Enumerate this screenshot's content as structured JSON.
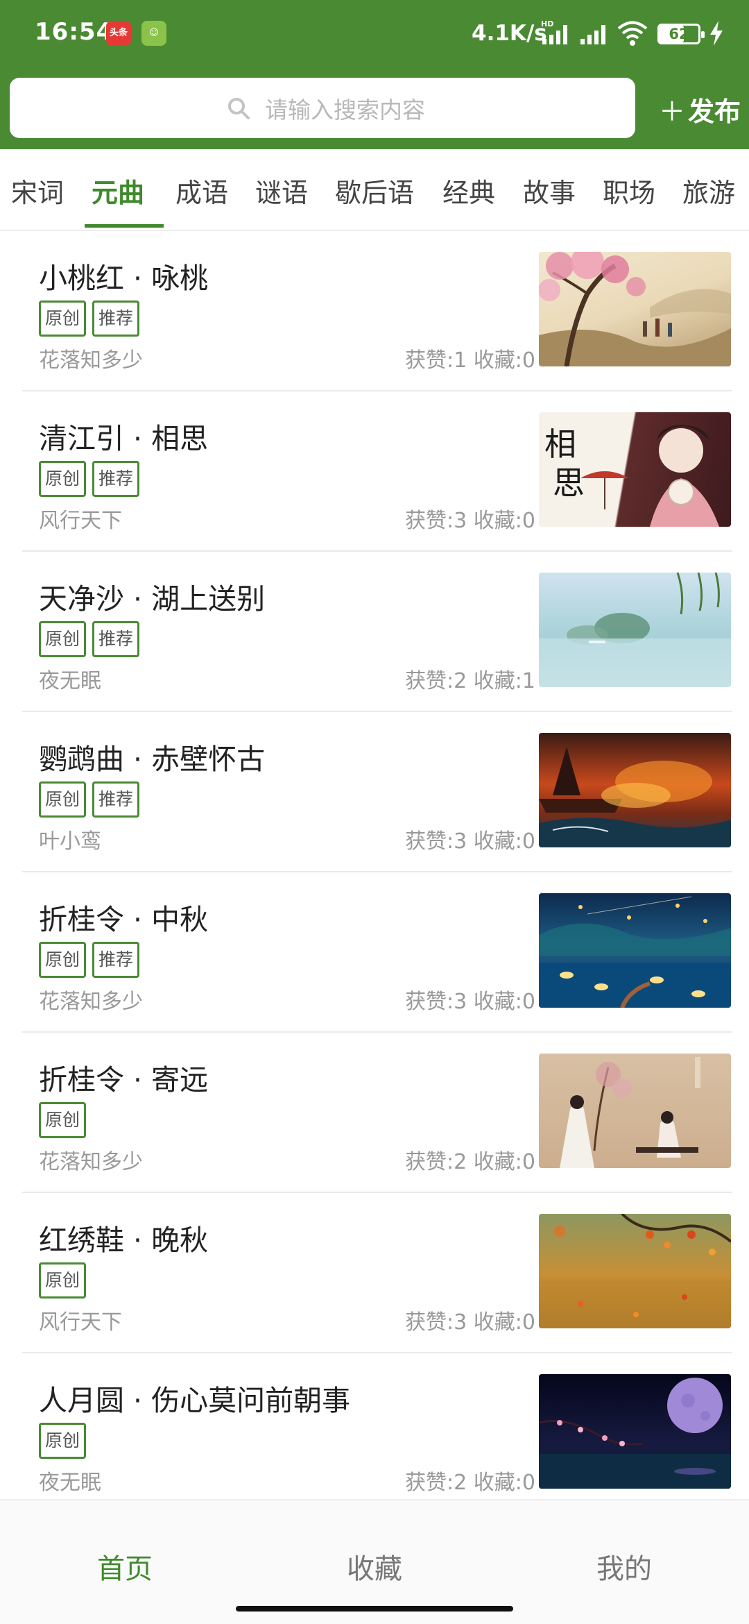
{
  "status_bar": {
    "time": "16:54",
    "app_icons": [
      "头条",
      "☺"
    ],
    "net_speed": "4.1K/s",
    "hd_label": "HD",
    "battery": "62",
    "battery_level": 0.62
  },
  "search": {
    "placeholder": "请输入搜索内容",
    "publish_label": "发布"
  },
  "tabs": [
    "宋词",
    "元曲",
    "成语",
    "谜语",
    "歇后语",
    "经典",
    "故事",
    "职场",
    "旅游"
  ],
  "active_tab": "元曲",
  "items": [
    {
      "title": "小桃红 · 咏桃",
      "tags": [
        "原创",
        "推荐"
      ],
      "author": "花落知多少",
      "stats": "获赞:1 收藏:0",
      "thumbnail": "peach-blossom-painting"
    },
    {
      "title": "清江引 · 相思",
      "tags": [
        "原创",
        "推荐"
      ],
      "author": "风行天下",
      "stats": "获赞:3 收藏:0",
      "thumbnail": "lovesick-girl-painting"
    },
    {
      "title": "天净沙 · 湖上送别",
      "tags": [
        "原创",
        "推荐"
      ],
      "author": "夜无眠",
      "stats": "获赞:2 收藏:1",
      "thumbnail": "misty-lake-painting"
    },
    {
      "title": "鹦鹉曲 · 赤壁怀古",
      "tags": [
        "原创",
        "推荐"
      ],
      "author": "叶小鸾",
      "stats": "获赞:3 收藏:0",
      "thumbnail": "red-cliff-battle-painting"
    },
    {
      "title": "折桂令 · 中秋",
      "tags": [
        "原创",
        "推荐"
      ],
      "author": "花落知多少",
      "stats": "获赞:3 收藏:0",
      "thumbnail": "lantern-night-painting"
    },
    {
      "title": "折桂令 · 寄远",
      "tags": [
        "原创"
      ],
      "author": "花落知多少",
      "stats": "获赞:2 收藏:0",
      "thumbnail": "guqin-player-painting"
    },
    {
      "title": "红绣鞋 · 晚秋",
      "tags": [
        "原创"
      ],
      "author": "风行天下",
      "stats": "获赞:3 收藏:0",
      "thumbnail": "autumn-leaves-photo"
    },
    {
      "title": "人月圆 · 伤心莫问前朝事",
      "tags": [
        "原创"
      ],
      "author": "夜无眠",
      "stats": "获赞:2 收藏:0",
      "thumbnail": "moon-night-painting"
    }
  ],
  "thumb_art": {
    "peach_text": "",
    "lovesick_text": "相思"
  },
  "bottom_nav": [
    "首页",
    "收藏",
    "我的"
  ],
  "colors": {
    "primary": "#4a8a33",
    "tab_active": "#3f8a2c",
    "tag_border": "#4a8a33"
  }
}
